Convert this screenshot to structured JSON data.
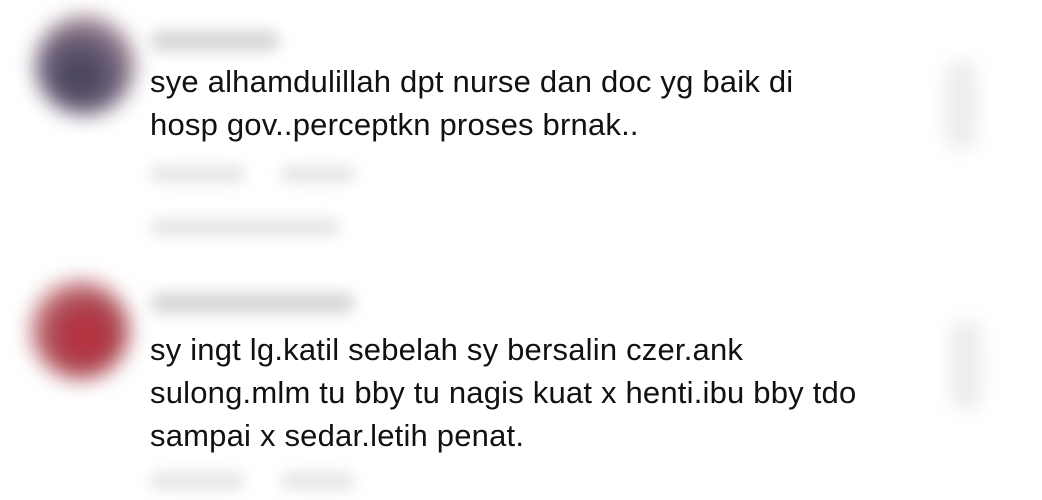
{
  "comments": [
    {
      "lines": [
        "sye alhamdulillah dpt nurse dan doc yg baik di",
        "hosp gov..perceptkn proses brnak.."
      ]
    },
    {
      "lines": [
        "sy ingt lg.katil sebelah sy bersalin czer.ank",
        "sulong.mlm tu bby tu nagis kuat x henti.ibu bby tdo",
        "sampai x sedar.letih penat."
      ]
    }
  ],
  "colors": {
    "text": "#111111",
    "background": "#ffffff",
    "avatar1": "#4a4660",
    "avatar2": "#b23a44"
  }
}
